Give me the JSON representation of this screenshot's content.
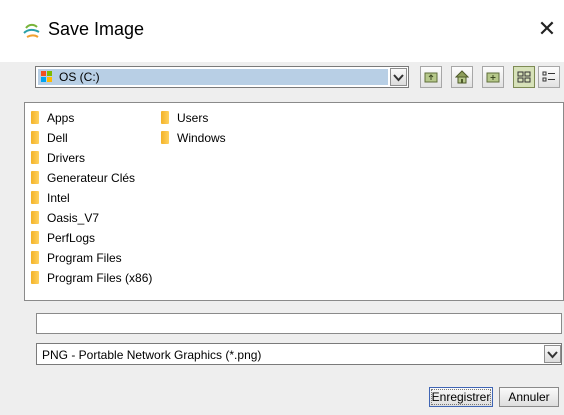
{
  "window": {
    "title": "Save Image",
    "close_glyph": "✕"
  },
  "look_in": {
    "selected": "OS (C:)",
    "icon": "drive-icon"
  },
  "toolbar": {
    "buttons": [
      {
        "name": "up-one-level-icon"
      },
      {
        "name": "home-icon"
      },
      {
        "name": "new-folder-icon"
      },
      {
        "name": "list-view-icon",
        "active": true
      },
      {
        "name": "details-view-icon"
      }
    ]
  },
  "files": {
    "col1": [
      "Apps",
      "Dell",
      "Drivers",
      "Generateur Clés",
      "Intel",
      "Oasis_V7",
      "PerfLogs",
      "Program Files",
      "Program Files (x86)"
    ],
    "col2": [
      "Users",
      "Windows"
    ]
  },
  "file_name": {
    "value": ""
  },
  "file_type": {
    "selected": "PNG - Portable Network Graphics (*.png)"
  },
  "buttons": {
    "save": "Enregistrer",
    "cancel": "Annuler"
  },
  "colors": {
    "folder": "#f3b229",
    "selection": "#b8cfe5",
    "active_toggle": "#d7e2b9"
  }
}
